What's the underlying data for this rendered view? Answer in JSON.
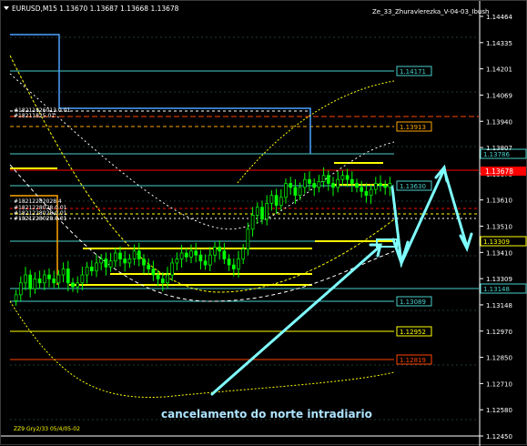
{
  "window": {
    "symbol_info": "EURUSD,M15  1.13670 1.13687 1.13668 1.13678",
    "indicator_name": "Ze_33_Zhuravlerezka_V-04-03_Ibush",
    "footer_label": "ZZ9 Gry2/33 05/4/05-02"
  },
  "colors": {
    "background": "#000000",
    "axis_text": "#ffffff",
    "grid": "#2f4f4f",
    "candle": "#00ff00",
    "teal_line": "#48d1cc",
    "yellow_line": "#ffff00",
    "red_line": "#ff0000",
    "annotation": "#7fffff",
    "annotation_text": "#aee4ff"
  },
  "price_axis": {
    "ticks": [
      "1.14464",
      "1.14335",
      "1.14201",
      "1.14069",
      "1.13940",
      "1.13807",
      "1.13678",
      "1.13610",
      "1.13510",
      "1.13410",
      "1.13309",
      "1.13148",
      "1.12970",
      "1.12850",
      "1.12710",
      "1.12580",
      "1.12450"
    ],
    "current_price": "1.13678"
  },
  "level_labels": [
    {
      "text": "1.14171",
      "color": "#48d1cc"
    },
    {
      "text": "1.13913",
      "color": "#ffa500"
    },
    {
      "text": "1.13786",
      "color": "#48d1cc"
    },
    {
      "text": "1.13630",
      "color": "#48d1cc"
    },
    {
      "text": "1.13309",
      "color": "#ffff00"
    },
    {
      "text": "1.13148",
      "color": "#48d1cc"
    },
    {
      "text": "1.13089",
      "color": "#48d1cc"
    },
    {
      "text": "1.12952",
      "color": "#ffff00"
    },
    {
      "text": "1.12819",
      "color": "#ff4500"
    }
  ],
  "chart_notes": {
    "upper_left_1": "#18211826013.0.01",
    "upper_left_2": "#18211825.01",
    "mid_left_1": "#18212282028.4",
    "mid_left_2": "#1821228028.0.01",
    "mid_left_3": "#1821228028.0.01",
    "mid_left_4": "#1821228028.0.01"
  },
  "annotation": {
    "caption": "cancelamento do norte intradiario"
  },
  "chart_data": {
    "type": "candlestick",
    "symbol": "EURUSD",
    "timeframe": "M15",
    "current_price": 1.13678,
    "ylim": [
      1.1241,
      1.1452
    ],
    "candles_close": [
      1.1312,
      1.1318,
      1.1322,
      1.1315,
      1.132,
      1.1318,
      1.1322,
      1.132,
      1.1318,
      1.1322,
      1.1325,
      1.1318,
      1.1316,
      1.1318,
      1.1322,
      1.1326,
      1.1324,
      1.1328,
      1.133,
      1.1326,
      1.1329,
      1.1333,
      1.133,
      1.1328,
      1.133,
      1.1334,
      1.133,
      1.1327,
      1.1325,
      1.1322,
      1.132,
      1.1318,
      1.1322,
      1.1328,
      1.133,
      1.1333,
      1.1331,
      1.1334,
      1.1332,
      1.1329,
      1.1327,
      1.1332,
      1.1336,
      1.1334,
      1.133,
      1.1327,
      1.1325,
      1.133,
      1.1335,
      1.1345,
      1.1352,
      1.1356,
      1.135,
      1.1358,
      1.1362,
      1.1357,
      1.1361,
      1.1368,
      1.1366,
      1.1362,
      1.1366,
      1.137,
      1.1368,
      1.1366,
      1.1369,
      1.1372,
      1.1368,
      1.1366,
      1.137,
      1.1372,
      1.137,
      1.1368,
      1.1366,
      1.1364,
      1.1362,
      1.1365,
      1.1368,
      1.1367,
      1.1366,
      1.1368
    ]
  }
}
